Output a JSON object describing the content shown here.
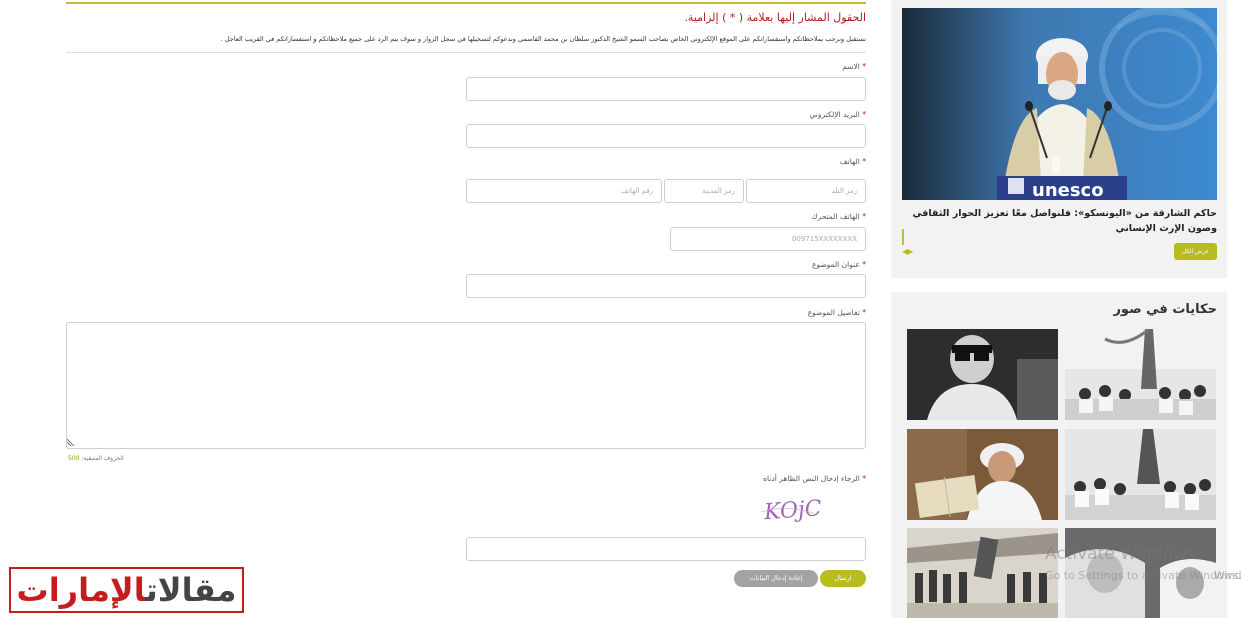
{
  "form": {
    "required_note": "الحقول المشار إليها بعلامة ( * ) إلزامية.",
    "intro": "نستقبل ونرحب بملاحظاتكم واستفساراتكم على الموقع الإلكتروني الخاص بصاحب السمو الشيخ الدكتور سلطان بن محمد القاسمي وندعوكم لتسجيلها في سجل الزوار و سوف يتم الرد على جميع ملاحظاتكم و استفساراتكم في القريب العاجل .",
    "required_mark": "*",
    "name_label": "الاسم",
    "email_label": "البريد الإلكتروني",
    "phone_label": "الهاتف",
    "phone_country_placeholder": "رمز البلد",
    "phone_city_placeholder": "رمز المدينة",
    "phone_number_placeholder": "رقم الهاتف",
    "mobile_label": "الهاتف المتحرك",
    "mobile_placeholder": "009715XXXXXXXX",
    "subject_label": "عنوان الموضوع",
    "details_label": "تفاصيل الموضوع",
    "chars_left_label": "الحروف المتبقية:",
    "chars_left_value": "500",
    "captcha_label": "الرجاء إدخال النص الظاهر أدناه",
    "captcha_text": "KOjC",
    "send_label": "ارسال",
    "reset_label": "إعادة إدخال البيانات"
  },
  "logo": {
    "dark_part": "مقالات",
    "red_part": "الإمارات"
  },
  "news": {
    "title": "حاكم الشارقة من «اليونسكو»: فلنواصل معًا تعزيز الحوار الثقافي وصون الإرث الإنساني",
    "view_all": "عرض الكل",
    "image_caption_text": "unesco"
  },
  "photos": {
    "title": "حكايات في صور"
  },
  "os_overlay": {
    "activate": "Activate Windows",
    "activate_sub": "Go to Settings to activate Windows.",
    "edge_fragment": "Wind"
  },
  "colors": {
    "accent": "#b8bc1e",
    "gold_rule": "#c9b63c",
    "required_red": "#b01d1d",
    "logo_red": "#c41d1d"
  }
}
